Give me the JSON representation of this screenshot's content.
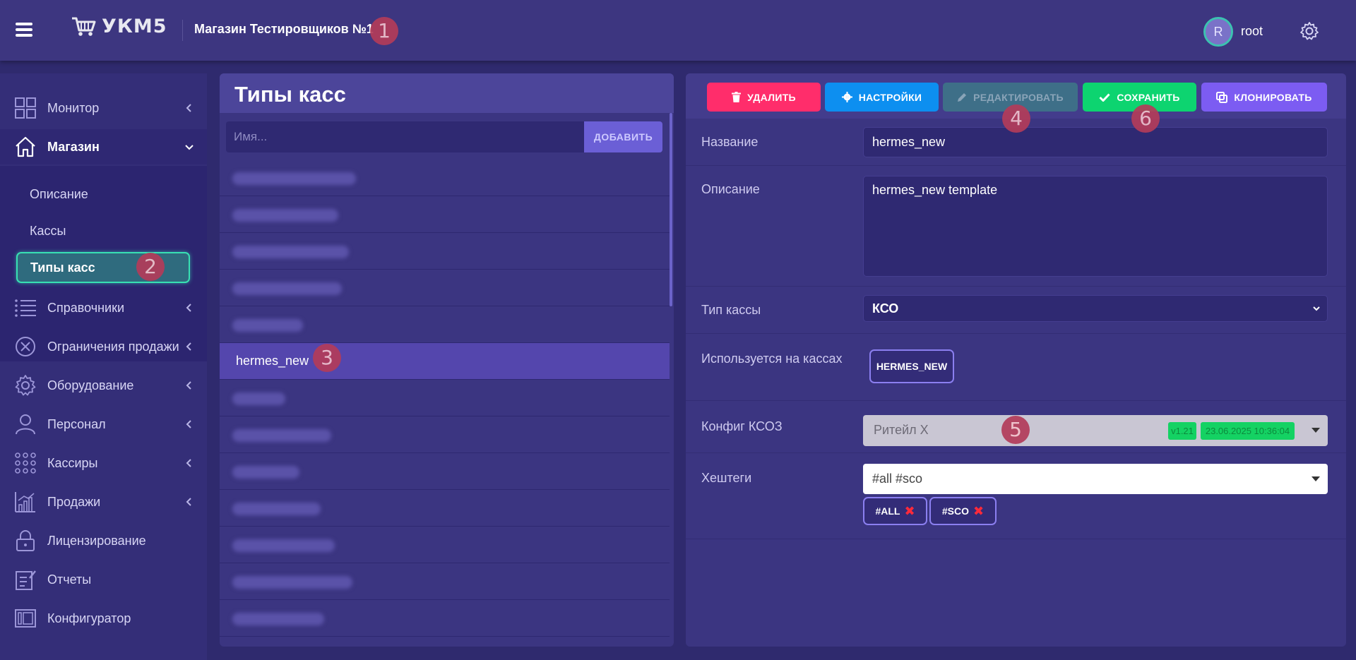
{
  "header": {
    "logo_text": "УКМ5",
    "store_name": "Магазин Тестировщиков №1",
    "user_initial": "R",
    "username": "root"
  },
  "markers": [
    "1",
    "2",
    "3",
    "4",
    "5",
    "6"
  ],
  "sidebar": {
    "items": [
      {
        "label": "Монитор",
        "icon": "grid-icon"
      },
      {
        "label": "Магазин",
        "icon": "home-icon"
      },
      {
        "label": "Справочники",
        "icon": "list-icon"
      },
      {
        "label": "Ограничения продажи",
        "icon": "circle-x-icon"
      },
      {
        "label": "Оборудование",
        "icon": "gear-icon"
      },
      {
        "label": "Персонал",
        "icon": "person-icon"
      },
      {
        "label": "Кассиры",
        "icon": "dots-grid-icon"
      },
      {
        "label": "Продажи",
        "icon": "chart-icon"
      },
      {
        "label": "Лицензирование",
        "icon": "lock-icon"
      },
      {
        "label": "Отчеты",
        "icon": "report-icon"
      },
      {
        "label": "Конфигуратор",
        "icon": "configurator-icon"
      }
    ],
    "submenu": [
      "Описание",
      "Кассы",
      "Типы касс"
    ]
  },
  "list": {
    "title": "Типы касс",
    "input_placeholder": "Имя...",
    "add_label": "ДОБАВИТЬ",
    "selected_row": "hermes_new"
  },
  "toolbar": {
    "delete": "УДАЛИТЬ",
    "settings": "НАСТРОЙКИ",
    "edit": "РЕДАКТИРОВАТЬ",
    "save": "СОХРАНИТЬ",
    "clone": "КЛОНИРОВАТЬ"
  },
  "form": {
    "name_label": "Название",
    "name_value": "hermes_new",
    "desc_label": "Описание",
    "desc_value": "hermes_new template",
    "type_label": "Тип кассы",
    "type_value": "КСО",
    "used_label": "Используется на кассах",
    "used_chip": "HERMES_NEW",
    "config_label": "Конфиг КСОЗ",
    "config_value": "Ритейл X",
    "config_version": "v1.21",
    "config_date": "23.06.2025 10:36:04",
    "hashtags_label": "Хештеги",
    "hashtags_value": "#all #sco",
    "tags": [
      "#ALL",
      "#SCO"
    ]
  },
  "colors": {
    "delete": "#ff2d6b",
    "settings": "#0d8ff0",
    "edit": "#3e6f88",
    "save": "#0dd470",
    "clone": "#7c5cf2",
    "accent_active": "#38e0b3"
  }
}
